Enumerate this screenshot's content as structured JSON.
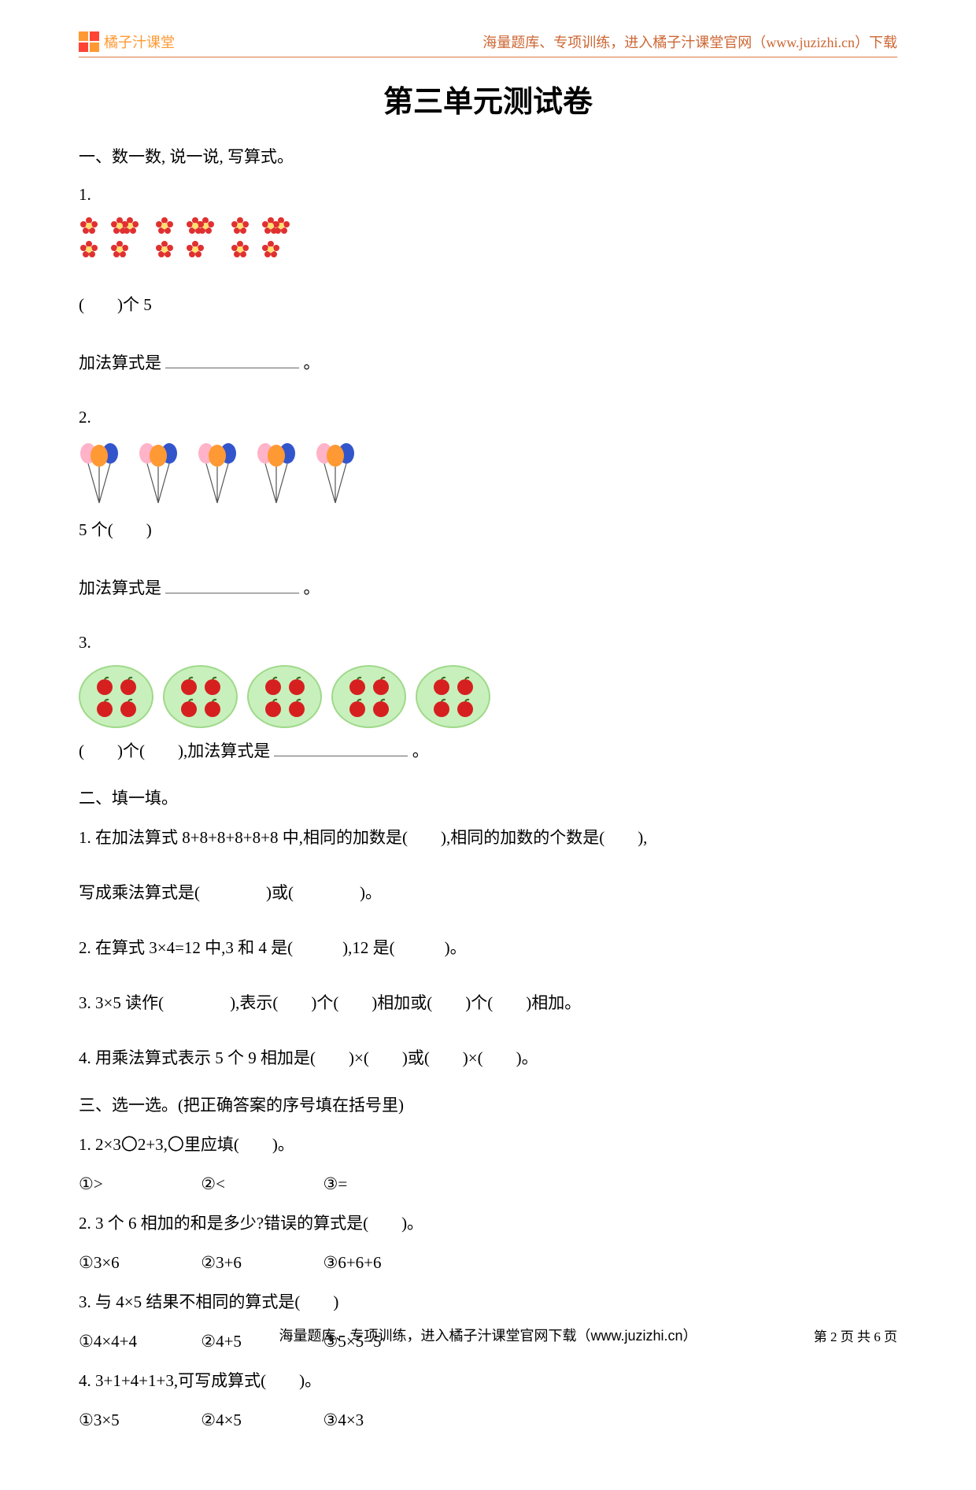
{
  "header": {
    "brand": "橘子汁课堂",
    "note": "海量题库、专项训练，进入橘子汁课堂官网（www.juzizhi.cn）下载"
  },
  "title": "第三单元测试卷",
  "s1": {
    "heading": "一、数一数, 说一说, 写算式。",
    "q1_num": "1.",
    "q1_blank_label": "(　　)个 5",
    "q1_add_prefix": "加法算式是",
    "q1_add_suffix": "。",
    "q2_num": "2.",
    "q2_blank_label": "5 个(　　)",
    "q2_add_prefix": "加法算式是",
    "q2_add_suffix": "。",
    "q3_num": "3.",
    "q3_text_a": "(　　)个(　　),加法算式是",
    "q3_text_b": "。"
  },
  "s2": {
    "heading": "二、填一填。",
    "q1": "1. 在加法算式 8+8+8+8+8+8 中,相同的加数是(　　),相同的加数的个数是(　　),",
    "q1b": "写成乘法算式是(　　　　)或(　　　　)。",
    "q2": "2. 在算式 3×4=12 中,3 和 4 是(　　　),12 是(　　　)。",
    "q3": "3. 3×5 读作(　　　　),表示(　　)个(　　)相加或(　　)个(　　)相加。",
    "q4": "4. 用乘法算式表示 5 个 9 相加是(　　)×(　　)或(　　)×(　　)。"
  },
  "s3": {
    "heading": "三、选一选。(把正确答案的序号填在括号里)",
    "q1": "1. 2×3〇2+3,〇里应填(　　)。",
    "q1_opts": {
      "a": "①>",
      "b": "②<",
      "c": "③="
    },
    "q2": "2. 3 个 6 相加的和是多少?错误的算式是(　　)。",
    "q2_opts": {
      "a": "①3×6",
      "b": "②3+6",
      "c": "③6+6+6"
    },
    "q3": "3. 与 4×5 结果不相同的算式是(　　)",
    "q3_opts": {
      "a": "①4×4+4",
      "b": "②4+5",
      "c": "③5×5−5"
    },
    "q4": "4. 3+1+4+1+3,可写成算式(　　)。",
    "q4_opts": {
      "a": "①3×5",
      "b": "②4×5",
      "c": "③4×3"
    }
  },
  "footer": {
    "text": "海量题库、专项训练，进入橘子汁课堂官网下载（www.juzizhi.cn）",
    "page": "第 2 页 共 6 页"
  }
}
